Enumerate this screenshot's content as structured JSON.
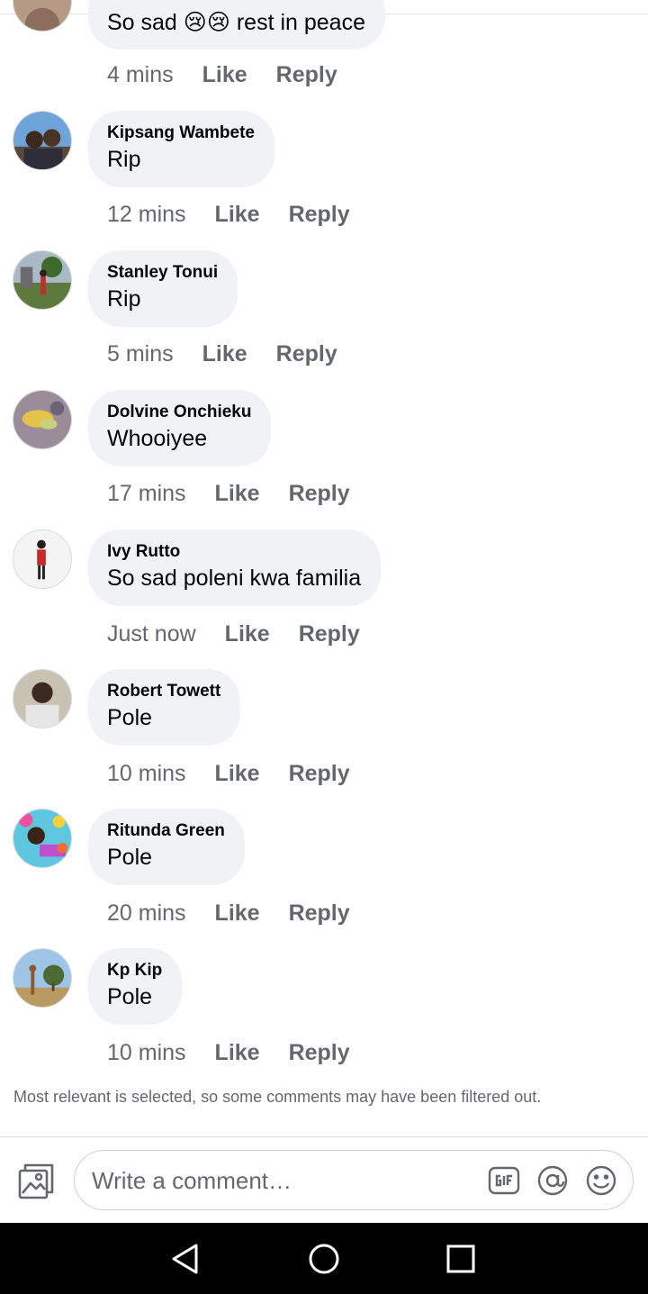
{
  "comments": [
    {
      "text": "So sad 😢😢 rest in peace",
      "time": "4 mins",
      "like": "Like",
      "reply": "Reply"
    },
    {
      "author": "Kipsang Wambete",
      "text": "Rip",
      "time": "12 mins",
      "like": "Like",
      "reply": "Reply"
    },
    {
      "author": "Stanley Tonui",
      "text": "Rip",
      "time": "5 mins",
      "like": "Like",
      "reply": "Reply"
    },
    {
      "author": "Dolvine Onchieku",
      "text": "Whooiyee",
      "time": "17 mins",
      "like": "Like",
      "reply": "Reply"
    },
    {
      "author": "Ivy Rutto",
      "text": "So sad poleni kwa familia",
      "time": "Just now",
      "like": "Like",
      "reply": "Reply"
    },
    {
      "author": "Robert Towett",
      "text": "Pole",
      "time": "10 mins",
      "like": "Like",
      "reply": "Reply"
    },
    {
      "author": "Ritunda Green",
      "text": "Pole",
      "time": "20 mins",
      "like": "Like",
      "reply": "Reply"
    },
    {
      "author": "Kp Kip",
      "text": "Pole",
      "time": "10 mins",
      "like": "Like",
      "reply": "Reply"
    }
  ],
  "filter_note": "Most relevant is selected, so some comments may have been filtered out.",
  "composer": {
    "placeholder": "Write a comment…",
    "icons": [
      "photo-icon",
      "gif-icon",
      "mention-icon",
      "emoji-icon"
    ]
  },
  "navbar": {
    "icons": [
      "back-icon",
      "home-icon",
      "recents-icon"
    ]
  },
  "colors": {
    "bubble": "#f0f2f5",
    "secondary_text": "#65676b",
    "primary_text": "#050505"
  }
}
